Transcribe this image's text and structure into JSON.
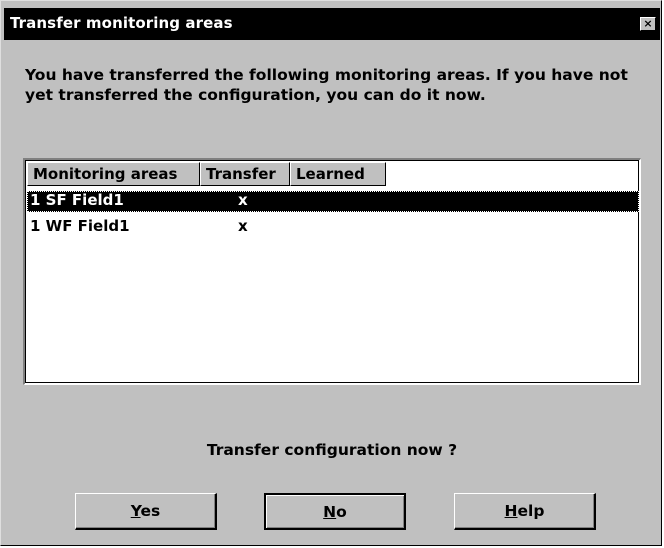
{
  "window": {
    "title": "Transfer monitoring areas",
    "close_label": "×"
  },
  "message": "You have transferred the following monitoring areas. If you have not yet transferred the configuration, you can do it now.",
  "list": {
    "columns": [
      "Monitoring areas",
      "Transfer",
      "Learned"
    ],
    "rows": [
      {
        "name": "1 SF Field1",
        "transfer": "x",
        "learned": "",
        "selected": true
      },
      {
        "name": "1 WF Field1",
        "transfer": "x",
        "learned": "",
        "selected": false
      }
    ]
  },
  "question": "Transfer configuration now ?",
  "buttons": {
    "yes": {
      "mnemonic": "Y",
      "rest": "es"
    },
    "no": {
      "mnemonic": "N",
      "rest": "o"
    },
    "help": {
      "mnemonic": "H",
      "rest": "elp"
    }
  },
  "colors": {
    "face": "#c0c0c0",
    "title_bar": "#000000",
    "selection": "#000000"
  }
}
